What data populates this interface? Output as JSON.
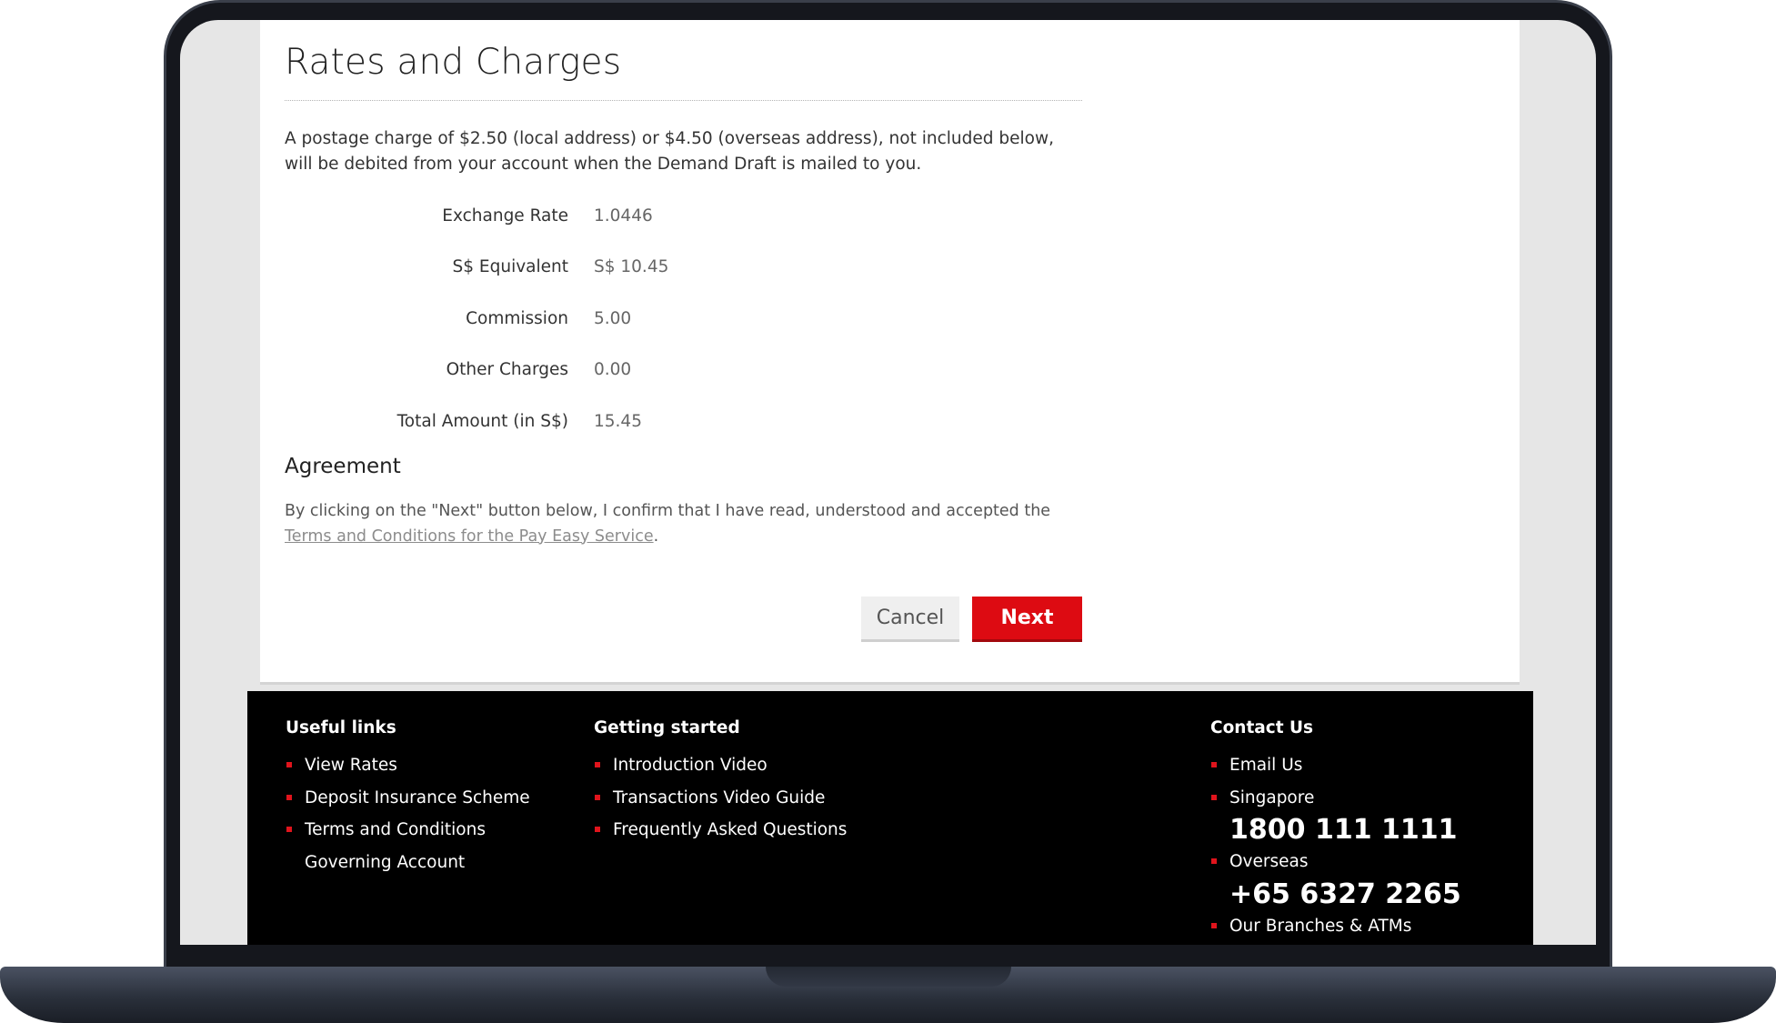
{
  "page": {
    "title": "Rates and Charges",
    "intro": "A postage charge of $2.50 (local address) or $4.50 (overseas address), not included below, will be debited from your account when the Demand Draft is mailed to you."
  },
  "rates": [
    {
      "label": "Exchange Rate",
      "value": "1.0446"
    },
    {
      "label": "S$  Equivalent",
      "value": "S$  10.45"
    },
    {
      "label": "Commission",
      "value": "5.00"
    },
    {
      "label": "Other Charges",
      "value": "0.00"
    },
    {
      "label": "Total Amount (in S$)",
      "value": "15.45"
    }
  ],
  "agreement": {
    "title": "Agreement",
    "text_before": "By clicking on the \"Next\" button below, I confirm that I have read, understood and accepted the ",
    "link": "Terms and Conditions for the Pay Easy Service",
    "text_after": "."
  },
  "buttons": {
    "cancel": "Cancel",
    "next": "Next"
  },
  "footer": {
    "useful_links": {
      "heading": "Useful links",
      "items": [
        "View Rates",
        "Deposit Insurance Scheme",
        "Terms and Conditions Governing Account"
      ]
    },
    "getting_started": {
      "heading": "Getting started",
      "items": [
        "Introduction Video",
        "Transactions Video Guide",
        "Frequently Asked Questions"
      ]
    },
    "contact": {
      "heading": "Contact Us",
      "email": "Email Us",
      "singapore_label": "Singapore",
      "singapore_phone": "1800 111 1111",
      "overseas_label": "Overseas",
      "overseas_phone": "+65 6327 2265",
      "branches": "Our Branches & ATMs"
    }
  },
  "colors": {
    "brand_red": "#dd0b12",
    "footer_bg": "#000000",
    "bullet_red": "#e0141c"
  }
}
